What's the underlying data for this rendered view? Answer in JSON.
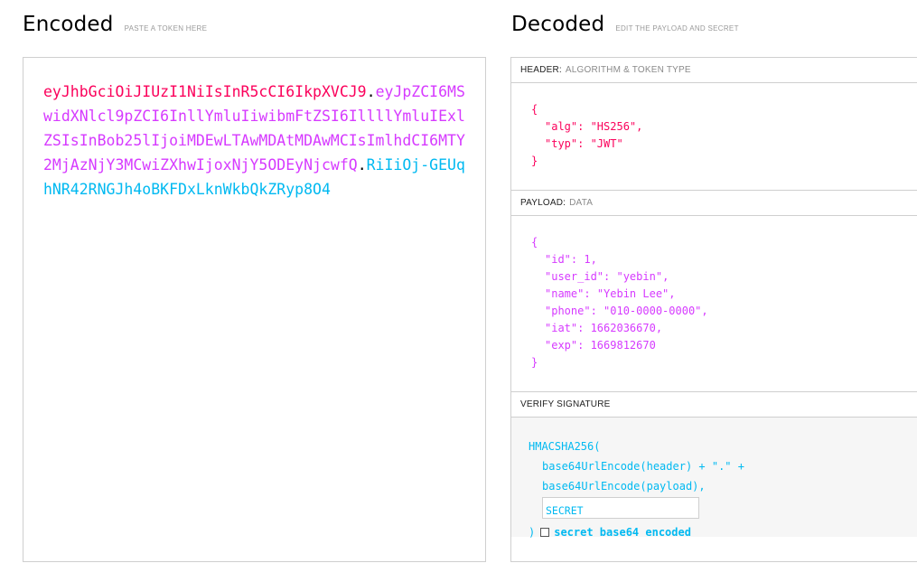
{
  "encoded": {
    "title": "Encoded",
    "hint": "PASTE A TOKEN HERE",
    "header_part": "eyJhbGciOiJIUzI1NiIsInR5cCI6IkpXVCJ9",
    "payload_part": "eyJpZCI6MSwidXNlcl9pZCI6InllYmluIiwibmFtZSI6IllllYmluIExlZSIsInBob25lIjoiMDEwLTAwMDAtMDAwMCIsImlhdCI6MTY2MjAzNjY3MCwiZXhwIjoxNjY5ODEyNjcwfQ",
    "signature_part": "RiIiOj-GEUqhNR42RNGJh4oBKFDxLknWkbQkZRyp8O4",
    "dot": "."
  },
  "decoded": {
    "title": "Decoded",
    "hint": "EDIT THE PAYLOAD AND SECRET",
    "header": {
      "label": "HEADER:",
      "sublabel": "ALGORITHM & TOKEN TYPE",
      "open": "{",
      "close": "}",
      "fields": [
        {
          "key": "\"alg\"",
          "value": "\"HS256\"",
          "sep": ","
        },
        {
          "key": "\"typ\"",
          "value": "\"JWT\"",
          "sep": ""
        }
      ]
    },
    "payload": {
      "label": "PAYLOAD:",
      "sublabel": "DATA",
      "open": "{",
      "close": "}",
      "fields": [
        {
          "key": "\"id\"",
          "value": "1",
          "sep": ","
        },
        {
          "key": "\"user_id\"",
          "value": "\"yebin\"",
          "sep": ","
        },
        {
          "key": "\"name\"",
          "value": "\"Yebin Lee\"",
          "sep": ","
        },
        {
          "key": "\"phone\"",
          "value": "\"010-0000-0000\"",
          "sep": ","
        },
        {
          "key": "\"iat\"",
          "value": "1662036670",
          "sep": ","
        },
        {
          "key": "\"exp\"",
          "value": "1669812670",
          "sep": ""
        }
      ]
    },
    "verify": {
      "label": "VERIFY SIGNATURE",
      "fn": "HMACSHA256(",
      "line1": "base64UrlEncode(header) + \".\" +",
      "line2": "base64UrlEncode(payload),",
      "secret_value": "SECRET",
      "close": ")",
      "checkbox_label": "secret base64 encoded"
    }
  }
}
